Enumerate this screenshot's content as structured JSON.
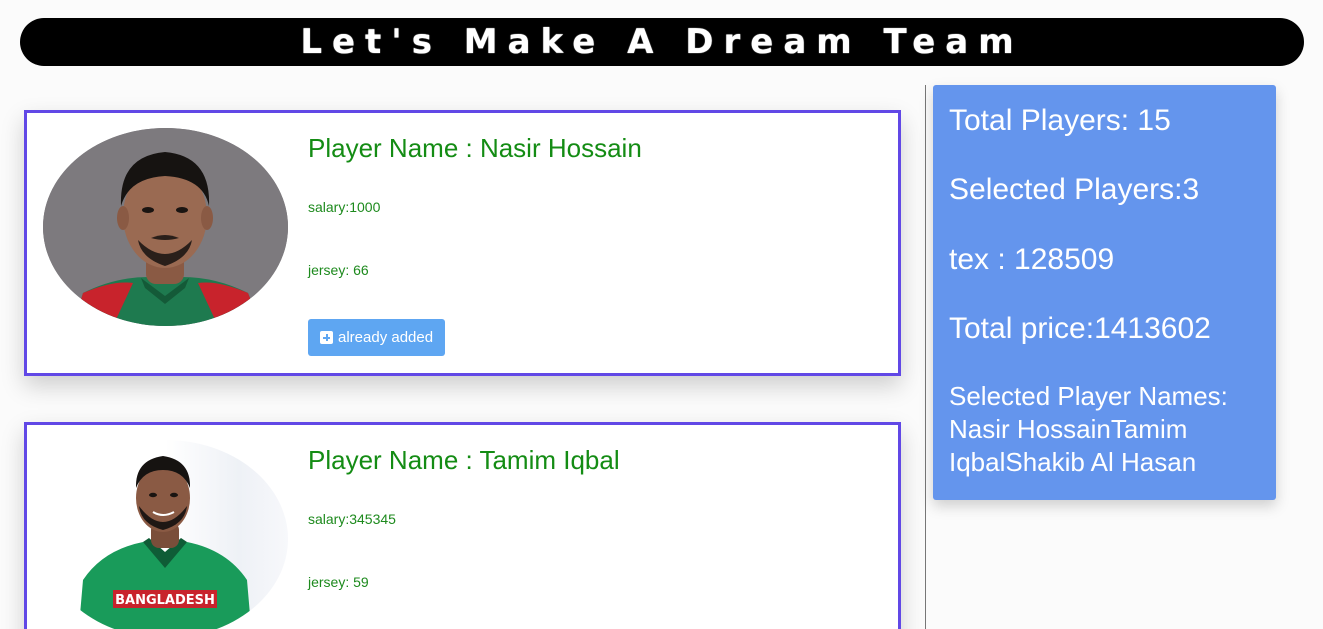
{
  "header": {
    "title": "Let's Make A Dream Team"
  },
  "players": [
    {
      "name_label": "Player Name : Nasir Hossain",
      "salary": "salary:1000",
      "jersey": "jersey: 66",
      "button_label": "already added"
    },
    {
      "name_label": "Player Name : Tamim Iqbal",
      "salary": "salary:345345",
      "jersey": "jersey: 59",
      "jersey_text": "BANGLADESH"
    }
  ],
  "summary": {
    "total_players": "Total Players: 15",
    "selected_players": "Selected Players:3",
    "tex": "tex : 128509",
    "total_price": "Total price:1413602",
    "names_heading": "Selected Player Names:",
    "names_value": "Nasir HossainTamim IqbalShakib Al Hasan"
  },
  "colors": {
    "header_bg": "#000000",
    "card_border": "#6148e6",
    "player_text": "#148c14",
    "button_bg": "#5ea6f2",
    "summary_bg": "#6495ed"
  },
  "icons": {
    "add_button": "plus-square-icon"
  }
}
